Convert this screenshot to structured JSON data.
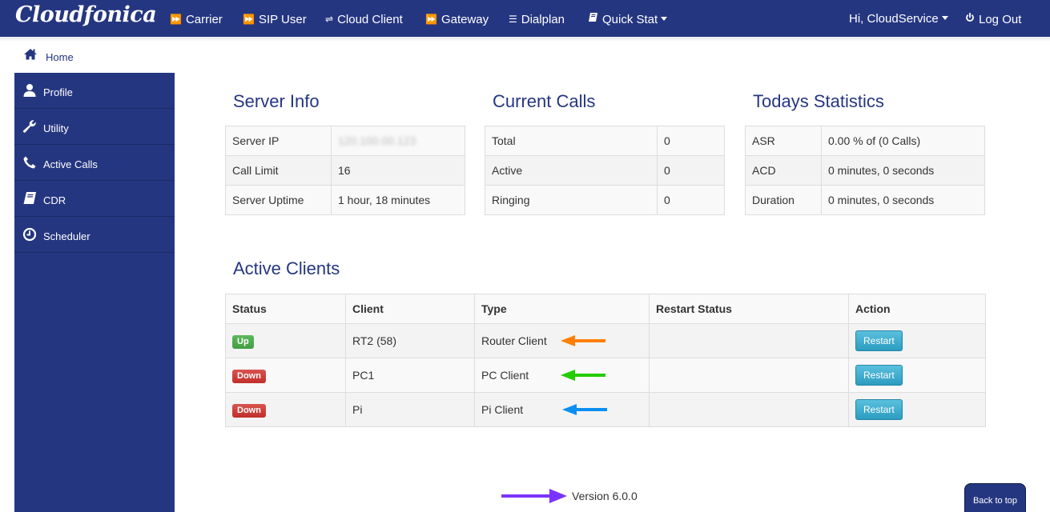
{
  "navbar": {
    "brand": "Cloudfonica",
    "items": [
      {
        "label": "Carrier",
        "icon": "fast-forward-icon"
      },
      {
        "label": "SIP User",
        "icon": "fast-forward-icon"
      },
      {
        "label": "Cloud Client",
        "icon": "random-icon"
      },
      {
        "label": "Gateway",
        "icon": "fast-forward-icon"
      },
      {
        "label": "Dialplan",
        "icon": "list-icon"
      },
      {
        "label": "Quick Stat",
        "icon": "book-icon",
        "dropdown": true
      }
    ],
    "user_menu": "Hi, CloudService",
    "logout": "Log Out"
  },
  "home": {
    "label": "Home",
    "icon": "home-icon"
  },
  "sidebar": {
    "items": [
      {
        "label": "Profile",
        "icon": "user-icon"
      },
      {
        "label": "Utility",
        "icon": "wrench-icon"
      },
      {
        "label": "Active Calls",
        "icon": "phone-icon"
      },
      {
        "label": "CDR",
        "icon": "book-icon"
      },
      {
        "label": "Scheduler",
        "icon": "clock-icon"
      }
    ]
  },
  "server_info": {
    "title": "Server Info",
    "rows": [
      {
        "label": "Server IP",
        "value": "120.100.00.123",
        "blurred": true
      },
      {
        "label": "Call Limit",
        "value": "16"
      },
      {
        "label": "Server Uptime",
        "value": "1 hour, 18 minutes"
      }
    ]
  },
  "current_calls": {
    "title": "Current Calls",
    "rows": [
      {
        "label": "Total",
        "value": "0"
      },
      {
        "label": "Active",
        "value": "0"
      },
      {
        "label": "Ringing",
        "value": "0"
      }
    ]
  },
  "todays_statistics": {
    "title": "Todays Statistics",
    "rows": [
      {
        "label": "ASR",
        "value": "0.00 % of (0 Calls)"
      },
      {
        "label": "ACD",
        "value": "0 minutes, 0 seconds"
      },
      {
        "label": "Duration",
        "value": "0 minutes, 0 seconds"
      }
    ]
  },
  "active_clients": {
    "title": "Active Clients",
    "columns": [
      "Status",
      "Client",
      "Type",
      "Restart Status",
      "Action"
    ],
    "rows": [
      {
        "status": "Up",
        "client": "RT2 (58)",
        "type": "Router Client",
        "restart_status": "",
        "action": "Restart",
        "arrow_color": "#ff7f00"
      },
      {
        "status": "Down",
        "client": "PC1",
        "type": "PC Client",
        "restart_status": "",
        "action": "Restart",
        "arrow_color": "#22cc00"
      },
      {
        "status": "Down",
        "client": "Pi",
        "type": "Pi Client",
        "restart_status": "",
        "action": "Restart",
        "arrow_color": "#0a8ef0"
      }
    ]
  },
  "footer": {
    "version": "Version 6.0.0",
    "arrow_color": "#7a33ff",
    "back_to_top": "Back to top"
  },
  "colors": {
    "primary": "#253681",
    "up": "#5cb85c",
    "down": "#d9534f",
    "info_button": "#31b0d5"
  }
}
